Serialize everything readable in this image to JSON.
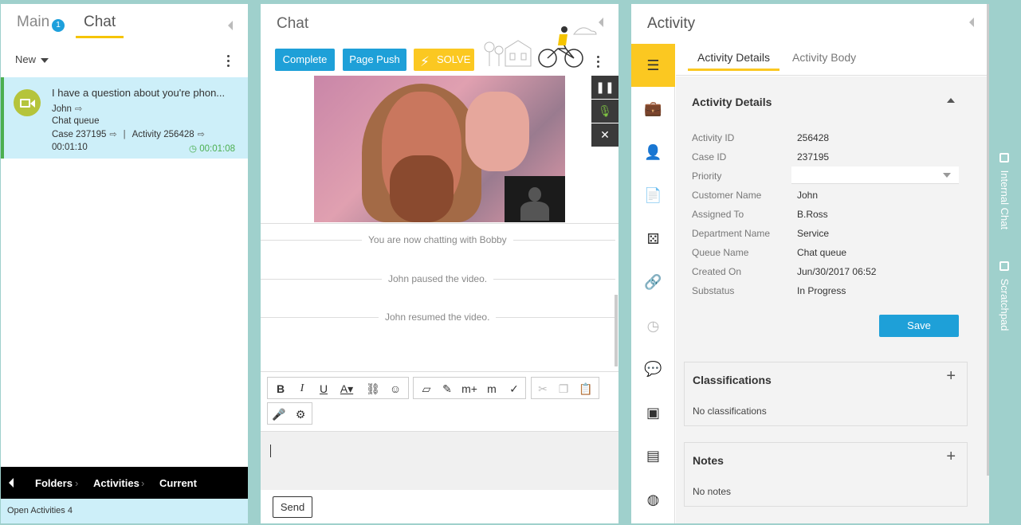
{
  "left": {
    "tabs": {
      "main": "Main",
      "main_badge": "1",
      "chat": "Chat"
    },
    "filter": "New",
    "conversation": {
      "title": "I have a question about you're phon...",
      "customer": "John",
      "queue": "Chat queue",
      "case": "Case 237195",
      "activity": "Activity 256428",
      "elapsed": "00:01:10",
      "timer": "00:01:08"
    },
    "breadcrumb": [
      "Folders",
      "Activities",
      "Current"
    ],
    "status": "Open Activities 4"
  },
  "center": {
    "title": "Chat",
    "buttons": {
      "complete": "Complete",
      "page_push": "Page Push",
      "solve": "SOLVE"
    },
    "messages": [
      "You are now chatting with Bobby",
      "John paused the video.",
      "John resumed the video."
    ],
    "send": "Send"
  },
  "right": {
    "title": "Activity",
    "subtabs": {
      "details": "Activity Details",
      "body": "Activity Body"
    },
    "section_title": "Activity Details",
    "fields": [
      {
        "label": "Activity ID",
        "value": "256428"
      },
      {
        "label": "Case ID",
        "value": "237195"
      },
      {
        "label": "Priority",
        "value": ""
      },
      {
        "label": "Customer Name",
        "value": "John"
      },
      {
        "label": "Assigned To",
        "value": "B.Ross"
      },
      {
        "label": "Department Name",
        "value": "Service"
      },
      {
        "label": "Queue Name",
        "value": "Chat queue"
      },
      {
        "label": "Created On",
        "value": "Jun/30/2017 06:52"
      },
      {
        "label": "Substatus",
        "value": "In Progress"
      }
    ],
    "save": "Save",
    "classifications": {
      "title": "Classifications",
      "empty": "No classifications"
    },
    "notes": {
      "title": "Notes",
      "empty": "No notes"
    }
  },
  "side_tabs": {
    "internal_chat": "Internal Chat",
    "scratchpad": "Scratchpad"
  },
  "colors": {
    "accent": "#1ea0d8",
    "yellow": "#fbc821",
    "teal_bg": "#9fd0cc"
  }
}
